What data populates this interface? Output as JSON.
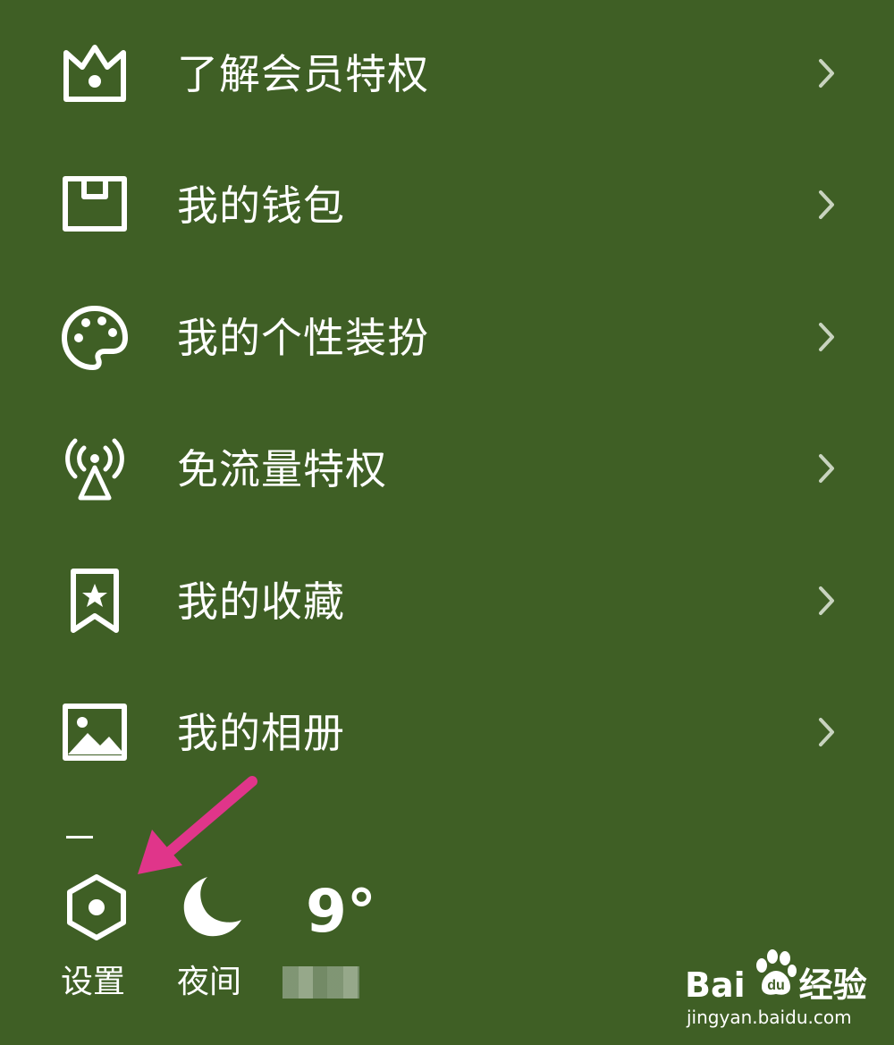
{
  "menu": {
    "items": [
      {
        "label": "了解会员特权",
        "icon": "crown-icon"
      },
      {
        "label": "我的钱包",
        "icon": "wallet-icon"
      },
      {
        "label": "我的个性装扮",
        "icon": "palette-icon"
      },
      {
        "label": "免流量特权",
        "icon": "antenna-icon"
      },
      {
        "label": "我的收藏",
        "icon": "bookmark-star-icon"
      },
      {
        "label": "我的相册",
        "icon": "photo-icon"
      }
    ]
  },
  "bottom_bar": {
    "settings_label": "设置",
    "night_label": "夜间",
    "temperature": "9°"
  },
  "watermark": {
    "brand_left": "Bai",
    "brand_right": "经验",
    "url": "jingyan.baidu.com"
  },
  "colors": {
    "background": "#3f5f25",
    "foreground": "#ffffff",
    "chevron": "#c8d3bf",
    "annotation_arrow": "#e0358a"
  }
}
